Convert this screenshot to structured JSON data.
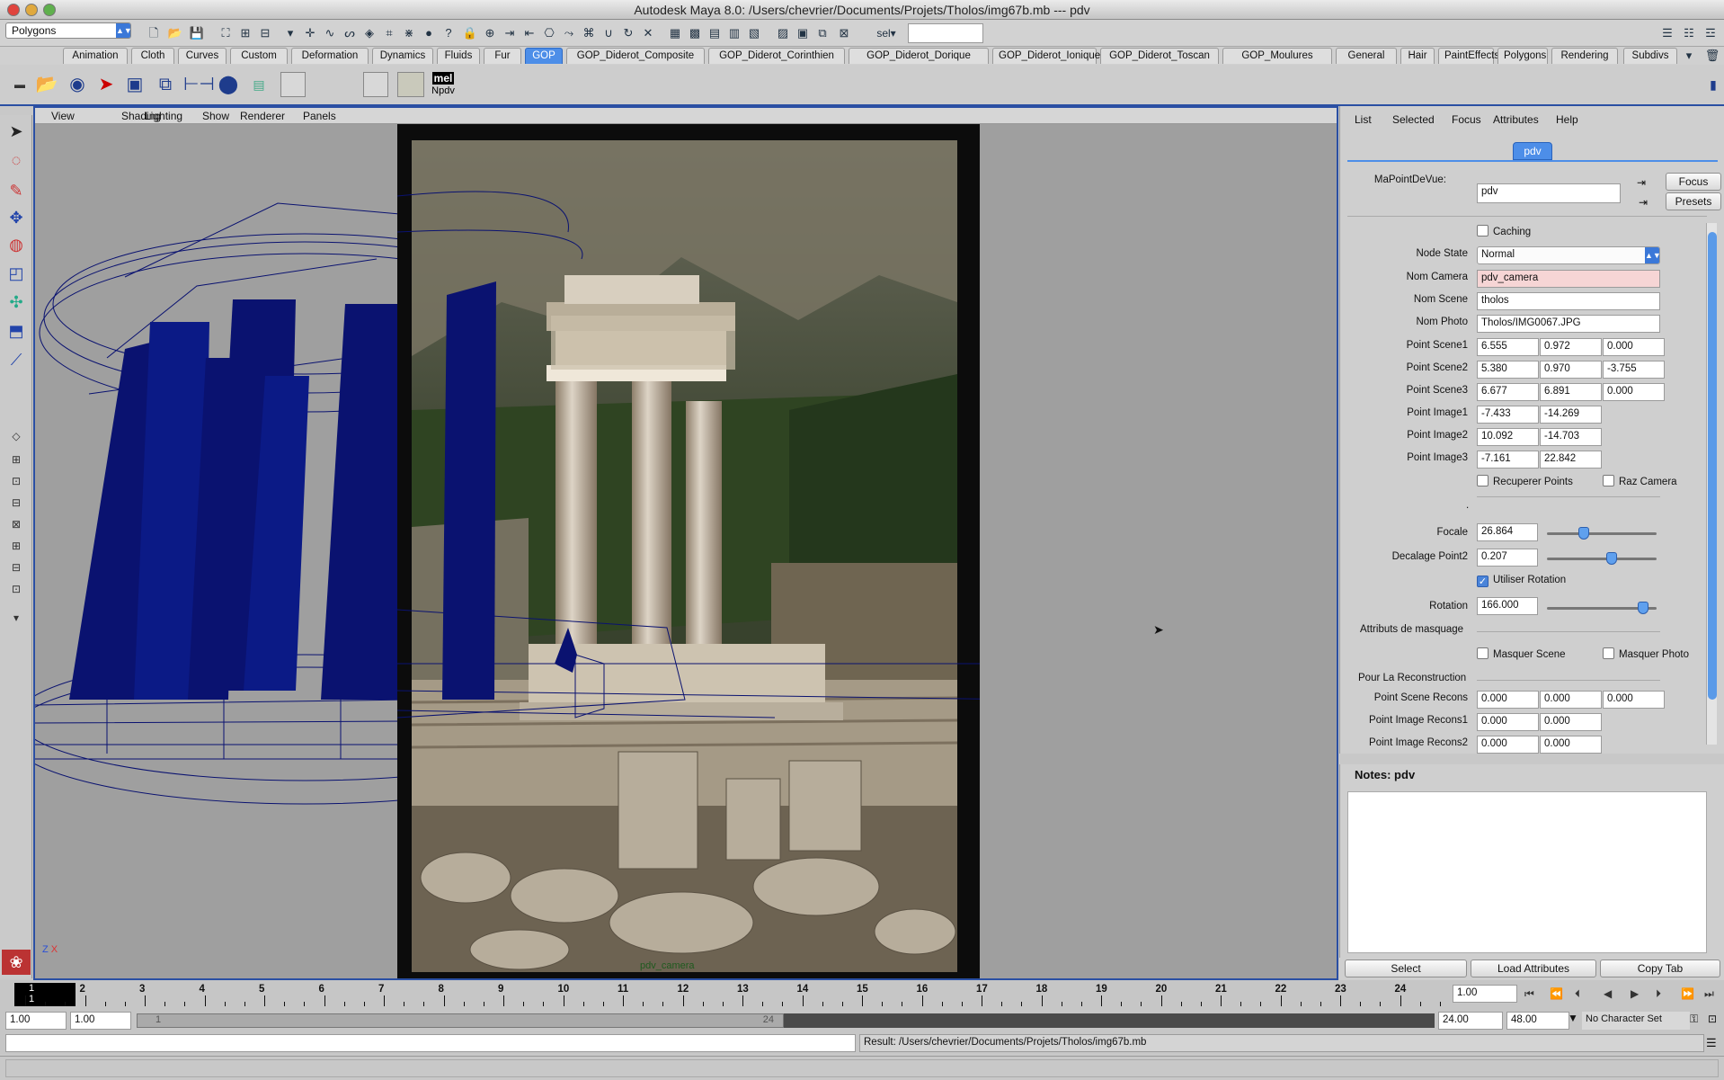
{
  "window": {
    "title": "Autodesk Maya 8.0: /Users/chevrier/Documents/Projets/Tholos/img67b.mb   ---   pdv"
  },
  "statusline": {
    "mode": "Polygons",
    "sel_label": "sel"
  },
  "shelf_tabs": [
    "Animation",
    "Cloth",
    "Curves",
    "Custom",
    "Deformation",
    "Dynamics",
    "Fluids",
    "Fur",
    "GOP",
    "GOP_Diderot_Composite",
    "GOP_Diderot_Corinthien",
    "GOP_Diderot_Dorique",
    "GOP_Diderot_Ionique",
    "GOP_Diderot_Toscan",
    "GOP_Moulures",
    "General",
    "Hair",
    "PaintEffects",
    "Polygons",
    "Rendering",
    "Subdivs"
  ],
  "active_shelf_tab": "GOP",
  "shelf": {
    "mel_label": "mel",
    "npdv_label": "Npdv"
  },
  "panel_menu": [
    "View",
    "Shading",
    "Lighting",
    "Show",
    "Renderer",
    "Panels"
  ],
  "viewport": {
    "camera_label": "pdv_camera",
    "axes": {
      "z": "Z",
      "x": "X"
    }
  },
  "attr_editor": {
    "menu": [
      "List",
      "Selected",
      "Focus",
      "Attributes",
      "Help"
    ],
    "node_tab": "pdv",
    "node_type_label": "MaPointDeVue:",
    "node_name": "pdv",
    "focus_button": "Focus",
    "presets_button": "Presets",
    "caching_label": "Caching",
    "node_state_label": "Node State",
    "node_state_value": "Normal",
    "nom_camera_label": "Nom Camera",
    "nom_camera": "pdv_camera",
    "nom_scene_label": "Nom Scene",
    "nom_scene": "tholos",
    "nom_photo_label": "Nom Photo",
    "nom_photo": "Tholos/IMG0067.JPG",
    "points": [
      {
        "label": "Point Scene1",
        "values": [
          "6.555",
          "0.972",
          "0.000"
        ]
      },
      {
        "label": "Point Scene2",
        "values": [
          "5.380",
          "0.970",
          "-3.755"
        ]
      },
      {
        "label": "Point Scene3",
        "values": [
          "6.677",
          "6.891",
          "0.000"
        ]
      },
      {
        "label": "Point Image1",
        "values": [
          "-7.433",
          "-14.269"
        ]
      },
      {
        "label": "Point Image2",
        "values": [
          "10.092",
          "-14.703"
        ]
      },
      {
        "label": "Point Image3",
        "values": [
          "-7.161",
          "22.842"
        ]
      }
    ],
    "recuperer_points": "Recuperer Points",
    "raz_camera": "Raz Camera",
    "dot": ".",
    "focale_label": "Focale",
    "focale": "26.864",
    "focale_slider": 0.32,
    "decalage_label": "Decalage Point2",
    "decalage": "0.207",
    "decalage_slider": 0.6,
    "utiliser_rotation": "Utiliser Rotation",
    "rotation_label": "Rotation",
    "rotation": "166.000",
    "rotation_slider": 0.92,
    "masquage_label": "Attributs de masquage",
    "masquer_scene": "Masquer Scene",
    "masquer_photo": "Masquer Photo",
    "reconstruction_label": "Pour La Reconstruction",
    "recons": [
      {
        "label": "Point Scene Recons",
        "values": [
          "0.000",
          "0.000",
          "0.000"
        ]
      },
      {
        "label": "Point Image Recons1",
        "values": [
          "0.000",
          "0.000"
        ]
      },
      {
        "label": "Point Image Recons2",
        "values": [
          "0.000",
          "0.000"
        ]
      }
    ],
    "notes_title": "Notes: pdv",
    "buttons": {
      "select": "Select",
      "load": "Load Attributes",
      "copy": "Copy Tab"
    }
  },
  "timeline": {
    "frames": [
      "1",
      "2",
      "3",
      "4",
      "5",
      "6",
      "7",
      "8",
      "9",
      "10",
      "11",
      "12",
      "13",
      "14",
      "15",
      "16",
      "17",
      "18",
      "19",
      "20",
      "21",
      "22",
      "23",
      "24"
    ],
    "current_frame": "1",
    "current_frame_sub": "1",
    "current_time": "1.00"
  },
  "range": {
    "start": "1.00",
    "playback_start": "1.00",
    "range_in": "1",
    "range_out": "24",
    "playback_end": "24.00",
    "end": "48.00",
    "character_set": "No Character Set"
  },
  "command": {
    "result": "Result:  /Users/chevrier/Documents/Projets/Tholos/img67b.mb"
  },
  "colors": {
    "accent": "#4d8ee8",
    "wire": "#0a1270",
    "viewport_bg": "#9f9f9f"
  }
}
